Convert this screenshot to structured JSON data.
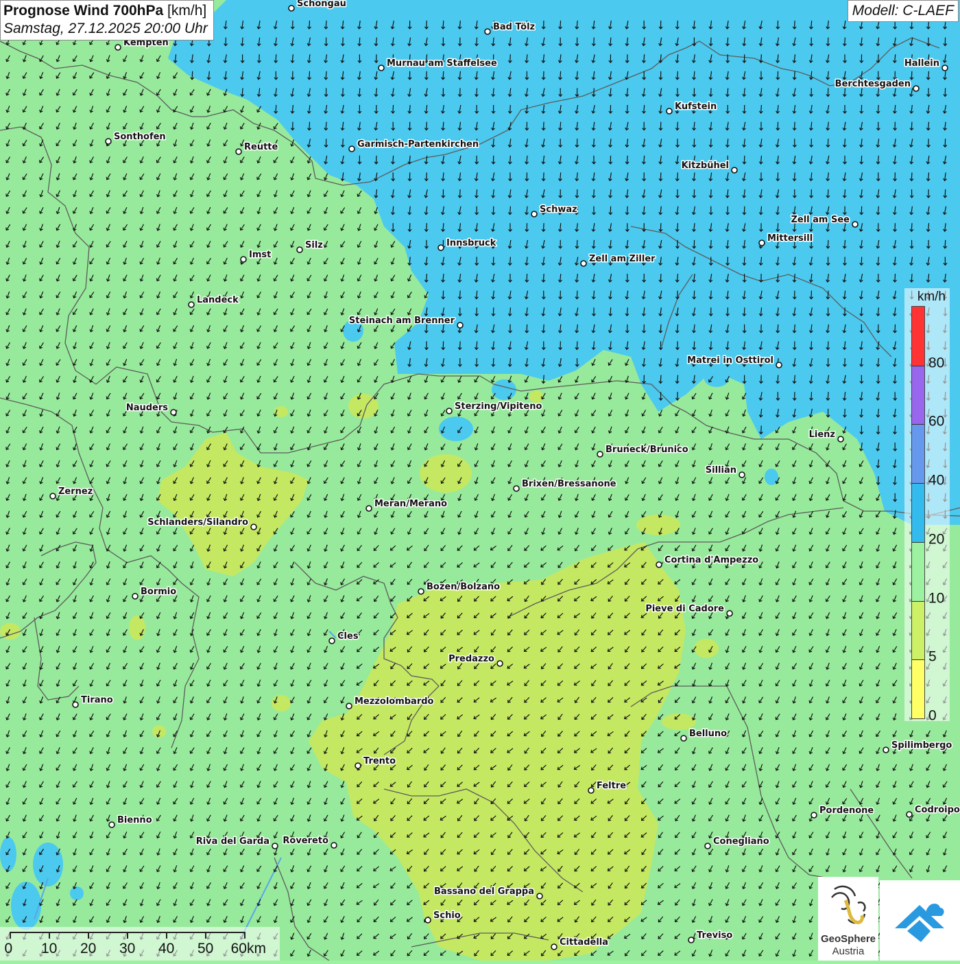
{
  "header": {
    "title_bold": "Prognose Wind 700hPa",
    "title_unit": "[km/h]",
    "datetime": "Samstag, 27.12.2025 20:00 Uhr",
    "model": "Modell: C-LAEF"
  },
  "legend": {
    "unit": "km/h",
    "labels": [
      "80",
      "60",
      "40",
      "20",
      "10",
      "5",
      "0"
    ],
    "bands": [
      {
        "color": "#ff3333"
      },
      {
        "color": "#9966ee"
      },
      {
        "color": "#6699ee"
      },
      {
        "color": "#33bbee"
      },
      {
        "color": "#9cf2a0"
      },
      {
        "color": "#ccf066"
      },
      {
        "color": "#ffff66"
      }
    ]
  },
  "scalebar": {
    "labels": [
      "0",
      "10",
      "20",
      "30",
      "40",
      "50",
      "60km"
    ]
  },
  "logo": {
    "line1": "GeoSphere",
    "line2": "Austria",
    "icon_left": "geosphere-logo-icon",
    "icon_right": "cloud-arrow-icon"
  },
  "colors": {
    "wind_10_20": "#9cf2a0",
    "wind_20_40": "#4fd0f7",
    "wind_5_10": "#ccf066",
    "arrow": "#111111"
  },
  "cities": [
    {
      "name": "Schongau"
    },
    {
      "name": "Bad Tölz"
    },
    {
      "name": "Kempten"
    },
    {
      "name": "Murnau am Staffelsee"
    },
    {
      "name": "Hallein"
    },
    {
      "name": "Berchtesgaden"
    },
    {
      "name": "Kufstein"
    },
    {
      "name": "Sonthofen"
    },
    {
      "name": "Reutte"
    },
    {
      "name": "Garmisch-Partenkirchen"
    },
    {
      "name": "Kitzbühel"
    },
    {
      "name": "Schwaz"
    },
    {
      "name": "Zell am See"
    },
    {
      "name": "Innsbruck"
    },
    {
      "name": "Mittersill"
    },
    {
      "name": "Silz"
    },
    {
      "name": "Imst"
    },
    {
      "name": "Zell am Ziller"
    },
    {
      "name": "Landeck"
    },
    {
      "name": "Steinach am Brenner"
    },
    {
      "name": "Matrei in Osttirol"
    },
    {
      "name": "Nauders"
    },
    {
      "name": "Sterzing/Vipiteno"
    },
    {
      "name": "Lienz"
    },
    {
      "name": "Bruneck/Brunico"
    },
    {
      "name": "Sillian"
    },
    {
      "name": "Brixen/Bressanone"
    },
    {
      "name": "Zernez"
    },
    {
      "name": "Meran/Merano"
    },
    {
      "name": "Schlanders/Silandro"
    },
    {
      "name": "Cortina d'Ampezzo"
    },
    {
      "name": "Bozen/Bolzano"
    },
    {
      "name": "Bormio"
    },
    {
      "name": "Pieve di Cadore"
    },
    {
      "name": "Cles"
    },
    {
      "name": "Predazzo"
    },
    {
      "name": "Tirano"
    },
    {
      "name": "Mezzolombardo"
    },
    {
      "name": "Belluno"
    },
    {
      "name": "Spilimbergo"
    },
    {
      "name": "Trento"
    },
    {
      "name": "Feltre"
    },
    {
      "name": "Pordenone"
    },
    {
      "name": "Codroipo"
    },
    {
      "name": "Bienno"
    },
    {
      "name": "Riva del Garda"
    },
    {
      "name": "Rovereto"
    },
    {
      "name": "Conegliano"
    },
    {
      "name": "Bassano del Grappa"
    },
    {
      "name": "Schio"
    },
    {
      "name": "Treviso"
    },
    {
      "name": "Cittadella"
    }
  ]
}
